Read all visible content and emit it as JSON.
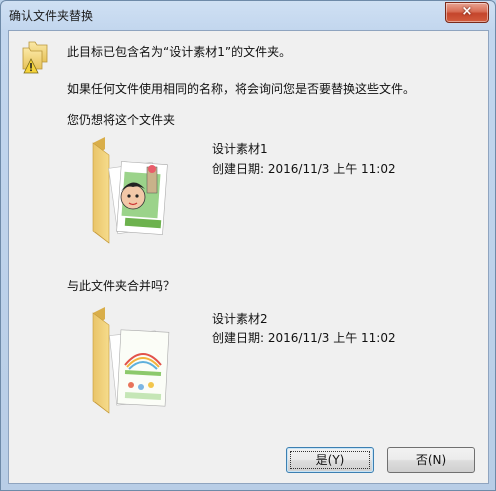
{
  "window": {
    "title": "确认文件夹替换",
    "close_label": "×"
  },
  "message": {
    "line1": "此目标已包含名为“设计素材1”的文件夹。",
    "line2": "如果任何文件使用相同的名称，将会询问您是否要替换这些文件。",
    "line3": "您仍想将这个文件夹"
  },
  "target_folder": {
    "name": "设计素材1",
    "created": "创建日期: 2016/11/3 上午 11:02"
  },
  "merge_question": "与此文件夹合并吗？",
  "source_folder": {
    "name": "设计素材2",
    "created": "创建日期: 2016/11/3 上午 11:02"
  },
  "buttons": {
    "yes": "是(Y)",
    "no": "否(N)"
  },
  "icons": {
    "warning": "folder-warning-icon",
    "folder_target": "folder-icon",
    "folder_source": "folder-icon"
  },
  "colors": {
    "title_bar": "#c2d6ee",
    "client_bg": "#f0f0f0",
    "close_button": "#c4452c",
    "folder": "#f2d27a"
  }
}
